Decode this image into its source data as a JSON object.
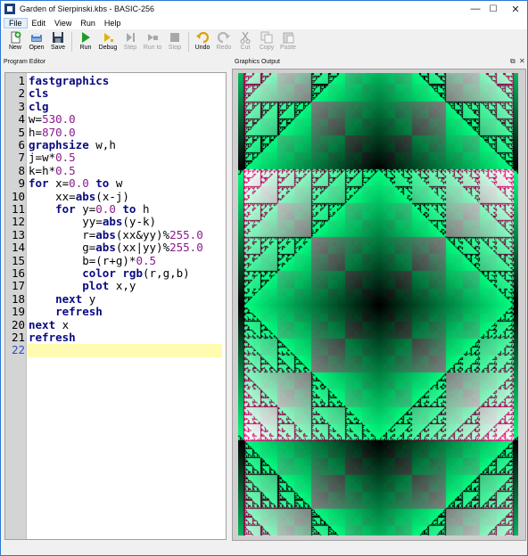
{
  "window": {
    "title": "Garden of Sierpinski.kbs - BASIC-256",
    "minimize_glyph": "—",
    "maximize_glyph": "☐",
    "close_glyph": "✕"
  },
  "menu": [
    "File",
    "Edit",
    "View",
    "Run",
    "Help"
  ],
  "toolbar": [
    {
      "label": "New",
      "icon": "new-file-icon",
      "enabled": true
    },
    {
      "label": "Open",
      "icon": "open-icon",
      "enabled": true
    },
    {
      "label": "Save",
      "icon": "save-icon",
      "enabled": true
    },
    {
      "label": "Run",
      "icon": "run-icon",
      "enabled": true
    },
    {
      "label": "Debug",
      "icon": "debug-icon",
      "enabled": true
    },
    {
      "label": "Step",
      "icon": "step-icon",
      "enabled": false
    },
    {
      "label": "Run to",
      "icon": "run-to-icon",
      "enabled": false
    },
    {
      "label": "Stop",
      "icon": "stop-icon",
      "enabled": false
    },
    {
      "label": "Undo",
      "icon": "undo-icon",
      "enabled": true
    },
    {
      "label": "Redo",
      "icon": "redo-icon",
      "enabled": false
    },
    {
      "label": "Cut",
      "icon": "cut-icon",
      "enabled": false
    },
    {
      "label": "Copy",
      "icon": "copy-icon",
      "enabled": false
    },
    {
      "label": "Paste",
      "icon": "paste-icon",
      "enabled": false
    }
  ],
  "editor": {
    "title": "Program Editor",
    "current_line": 22,
    "lines": [
      "fastgraphics",
      "cls",
      "clg",
      "w=530.0",
      "h=870.0",
      "graphsize w,h",
      "j=w*0.5",
      "k=h*0.5",
      "for x=0.0 to w",
      "    xx=abs(x-j)",
      "    for y=0.0 to h",
      "        yy=abs(y-k)",
      "        r=abs(xx&yy)%255.0",
      "        g=abs(xx|yy)%255.0",
      "        b=(r+g)*0.5",
      "        color rgb(r,g,b)",
      "        plot x,y",
      "    next y",
      "    refresh",
      "next x",
      "refresh",
      ""
    ]
  },
  "graphics": {
    "title": "Graphics Output",
    "float_glyph": "⧉",
    "close_glyph": "✕"
  },
  "colors": {
    "keyword": "#0a0a80",
    "number": "#8b1a8b",
    "current_line": "#fffbb0"
  }
}
